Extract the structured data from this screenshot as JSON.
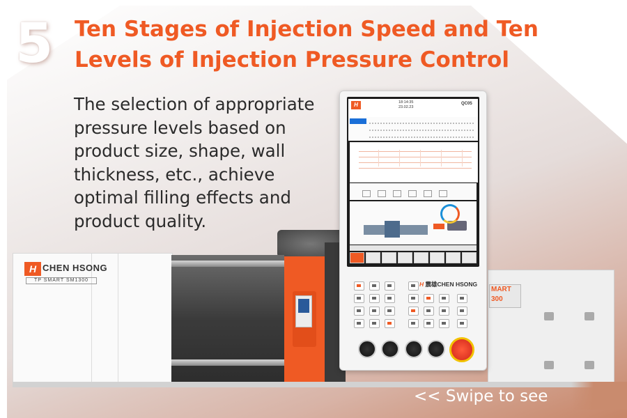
{
  "badge": {
    "number": "5"
  },
  "title": "Ten Stages of Injection Speed and Ten Levels of Injection Pressure Control",
  "description": "The selection of appropriate pressure levels based on product size, shape, wall thickness, etc., achieve optimal filling effects and product quality.",
  "swipe_hint": "<<  Swipe to see",
  "machine": {
    "brand": "CHEN HSONG",
    "logo_letter": "H",
    "model_plate": "TP SMART SM1300",
    "right_label": "MART\n300"
  },
  "controller": {
    "screen_time": "18:14:35\n23.02.23",
    "screen_model": "QC05",
    "brand": "CHEN HSONG",
    "brand_cn": "震雄"
  },
  "colors": {
    "accent": "#ef5a24",
    "text": "#2a2a2a"
  }
}
